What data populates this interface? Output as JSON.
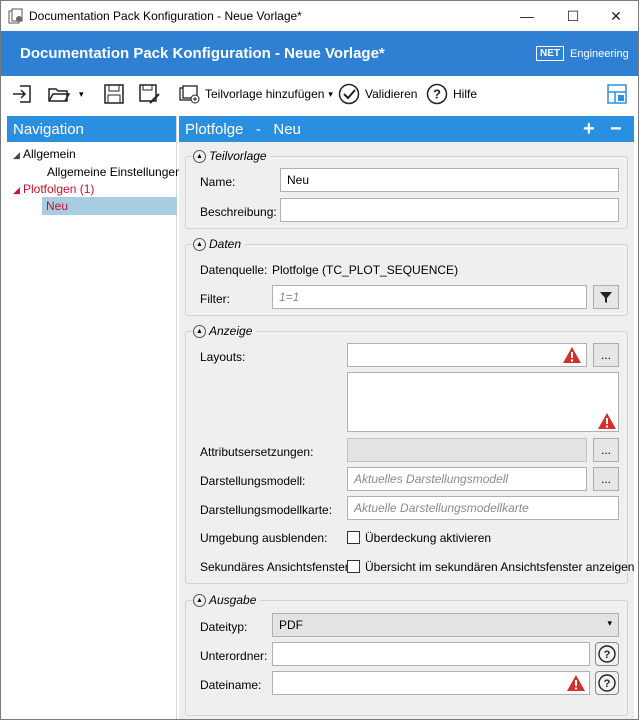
{
  "window": {
    "title": "Documentation Pack Konfiguration - Neue Vorlage*",
    "minimize": "—",
    "maximize": "☐",
    "close": "✕"
  },
  "banner": {
    "title": "Documentation Pack Konfiguration - Neue Vorlage*",
    "logo_box": "NET",
    "logo_text": "Engineering"
  },
  "toolbar": {
    "add_subtemplate": "Teilvorlage hinzufügen",
    "dropdown_arrow": "▾",
    "validate": "Validieren",
    "help": "Hilfe"
  },
  "nav": {
    "title": "Navigation",
    "items": [
      {
        "label": "Allgemein"
      },
      {
        "label": "Allgemeine Einstellungen"
      },
      {
        "label": "Plotfolgen (1)"
      },
      {
        "label": "Neu"
      }
    ]
  },
  "main": {
    "header_title": "Plotfolge   -   Neu",
    "add_symbol": "+",
    "remove_symbol": "−"
  },
  "teilvorlage": {
    "title": "Teilvorlage",
    "name_label": "Name:",
    "name_value": "Neu",
    "desc_label": "Beschreibung:",
    "desc_value": ""
  },
  "daten": {
    "title": "Daten",
    "source_label": "Datenquelle:",
    "source_value": "Plotfolge (TC_PLOT_SEQUENCE)",
    "filter_label": "Filter:",
    "filter_placeholder": "1=1"
  },
  "anzeige": {
    "title": "Anzeige",
    "layouts_label": "Layouts:",
    "attr_label": "Attributsersetzungen:",
    "model_label": "Darstellungsmodell:",
    "model_placeholder": "Aktuelles Darstellungsmodell",
    "map_label": "Darstellungsmodellkarte:",
    "map_placeholder": "Aktuelle Darstellungsmodellkarte",
    "env_label": "Umgebung ausblenden:",
    "env_check": "Überdeckung aktivieren",
    "sec_label": "Sekundäres Ansichtsfenster:",
    "sec_check": "Übersicht im sekundären Ansichtsfenster anzeigen",
    "ellipsis": "..."
  },
  "ausgabe": {
    "title": "Ausgabe",
    "type_label": "Dateityp:",
    "type_value": "PDF",
    "folder_label": "Unterordner:",
    "file_label": "Dateiname:"
  },
  "colors": {
    "banner": "#2f7fd3",
    "header": "#2b8fe0",
    "nav_selected": "#a9cde0",
    "nav_red": "#c8102e",
    "warning": "#d32f2f"
  }
}
